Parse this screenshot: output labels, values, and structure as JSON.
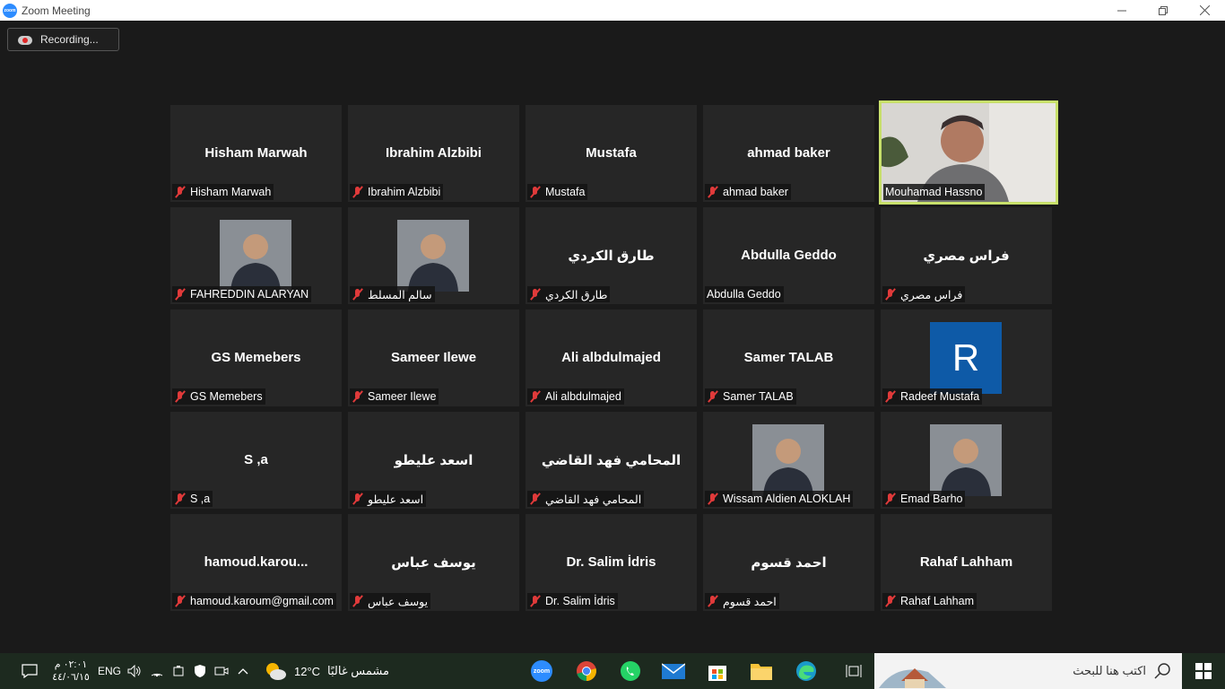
{
  "window": {
    "title": "Zoom Meeting"
  },
  "recording": {
    "label": "Recording..."
  },
  "participants": [
    {
      "name": "Hisham Marwah",
      "label": "Hisham Marwah",
      "muted": true,
      "type": "name"
    },
    {
      "name": "Ibrahim Alzbibi",
      "label": "Ibrahim Alzbibi",
      "muted": true,
      "type": "name"
    },
    {
      "name": "Mustafa",
      "label": "Mustafa",
      "muted": true,
      "type": "name"
    },
    {
      "name": "ahmad baker",
      "label": "ahmad baker",
      "muted": true,
      "type": "name"
    },
    {
      "name": "",
      "label": "Mouhamad Hassno",
      "muted": false,
      "type": "video"
    },
    {
      "name": "",
      "label": "FAHREDDIN ALARYAN",
      "muted": true,
      "type": "photo"
    },
    {
      "name": "",
      "label": "سالم المسلط",
      "muted": true,
      "type": "photo"
    },
    {
      "name": "طارق الكردي",
      "label": "طارق الكردي",
      "muted": true,
      "type": "name"
    },
    {
      "name": "Abdulla Geddo",
      "label": "Abdulla Geddo",
      "muted": false,
      "type": "name"
    },
    {
      "name": "فراس مصري",
      "label": "فراس مصري",
      "muted": true,
      "type": "name"
    },
    {
      "name": "GS Memebers",
      "label": "GS Memebers",
      "muted": true,
      "type": "name"
    },
    {
      "name": "Sameer Ilewe",
      "label": "Sameer Ilewe",
      "muted": true,
      "type": "name"
    },
    {
      "name": "Ali albdulmajed",
      "label": "Ali albdulmajed",
      "muted": true,
      "type": "name"
    },
    {
      "name": "Samer TALAB",
      "label": "Samer TALAB",
      "muted": true,
      "type": "name"
    },
    {
      "name": "R",
      "label": "Radeef Mustafa",
      "muted": true,
      "type": "initial"
    },
    {
      "name": "S ,a",
      "label": "S ,a",
      "muted": true,
      "type": "name"
    },
    {
      "name": "اسعد عليطو",
      "label": "اسعد عليطو",
      "muted": true,
      "type": "name"
    },
    {
      "name": "المحامي فهد القاضي",
      "label": "المحامي فهد القاضي",
      "muted": true,
      "type": "name"
    },
    {
      "name": "",
      "label": "Wissam Aldien ALOKLAH",
      "muted": true,
      "type": "photo"
    },
    {
      "name": "",
      "label": "Emad Barho",
      "muted": true,
      "type": "photo"
    },
    {
      "name": "hamoud.karou...",
      "label": "hamoud.karoum@gmail.com",
      "muted": true,
      "type": "name"
    },
    {
      "name": "يوسف عباس",
      "label": "يوسف عباس",
      "muted": true,
      "type": "name"
    },
    {
      "name": "Dr. Salim İdris",
      "label": "Dr. Salim İdris",
      "muted": true,
      "type": "name"
    },
    {
      "name": "احمد قسوم",
      "label": "احمد قسوم",
      "muted": true,
      "type": "name"
    },
    {
      "name": "Rahaf Lahham",
      "label": "Rahaf Lahham",
      "muted": true,
      "type": "name"
    }
  ],
  "taskbar": {
    "time": "٠٢:٠١ م",
    "date": "٤٤/٠٦/١٥",
    "language": "ENG",
    "temperature": "12°C",
    "weather": "مشمس غالبًا",
    "search_placeholder": "اكتب هنا للبحث",
    "zoom_icon_text": "zoom"
  },
  "colors": {
    "active_border": "#c8e06b",
    "tile_bg": "#262626",
    "muted_mic": "#e03a3a",
    "initial_bg": "#0e5aa7"
  }
}
